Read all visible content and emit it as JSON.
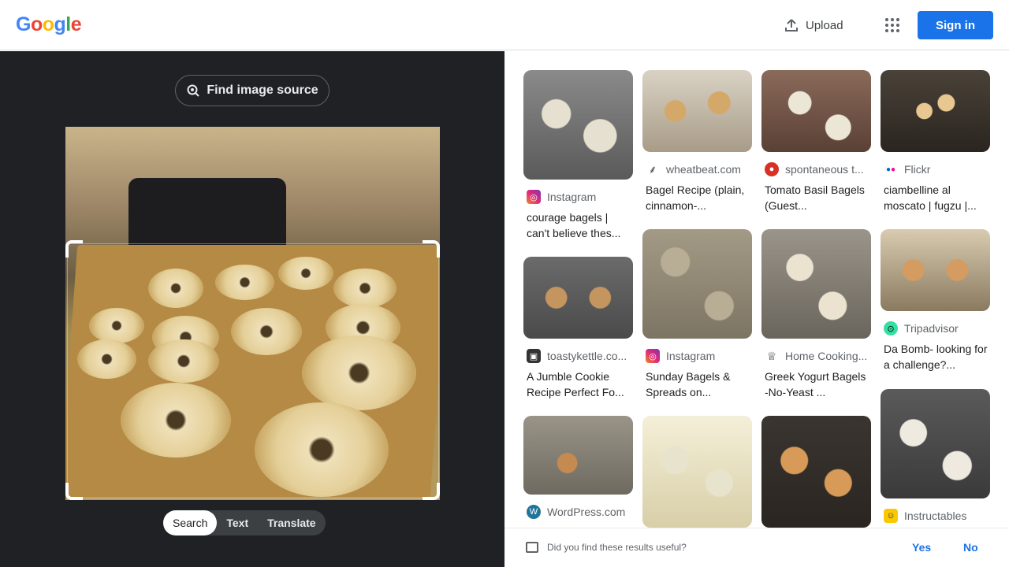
{
  "header": {
    "logo": "Google",
    "upload_label": "Upload",
    "apps_icon": "apps-grid-icon",
    "signin_label": "Sign in",
    "brand_color": "#1a73e8"
  },
  "lens": {
    "find_source_label": "Find image source",
    "modes": [
      "Search",
      "Text",
      "Translate"
    ],
    "active_mode": "Search"
  },
  "results": [
    {
      "source": "Instagram",
      "title": "courage bagels | can't believe thes...",
      "icon": "instagram-icon"
    },
    {
      "source": "wheatbeat.com",
      "title": "Bagel Recipe (plain, cinnamon-...",
      "icon": "wheat-icon"
    },
    {
      "source": "spontaneous t...",
      "title": "Tomato Basil Bagels (Guest...",
      "icon": "tomato-icon"
    },
    {
      "source": "Flickr",
      "title": "ciambelline al moscato | fugzu |...",
      "icon": "flickr-icon"
    },
    {
      "source": "toastykettle.co...",
      "title": "A Jumble Cookie Recipe Perfect Fo...",
      "icon": "toastykettle-icon"
    },
    {
      "source": "Instagram",
      "title": "Sunday Bagels & Spreads on...",
      "icon": "instagram-icon"
    },
    {
      "source": "Home Cooking...",
      "title": "Greek Yogurt Bagels -No-Yeast ...",
      "icon": "chef-hat-icon"
    },
    {
      "source": "Tripadvisor",
      "title": "Da Bomb- looking for a challenge?...",
      "icon": "tripadvisor-icon"
    },
    {
      "source": "WordPress.com",
      "title": "",
      "icon": "wordpress-icon"
    },
    {
      "source": "Instructables",
      "title": "",
      "icon": "instructables-icon"
    }
  ],
  "feedback": {
    "question": "Did you find these results useful?",
    "yes": "Yes",
    "no": "No"
  }
}
